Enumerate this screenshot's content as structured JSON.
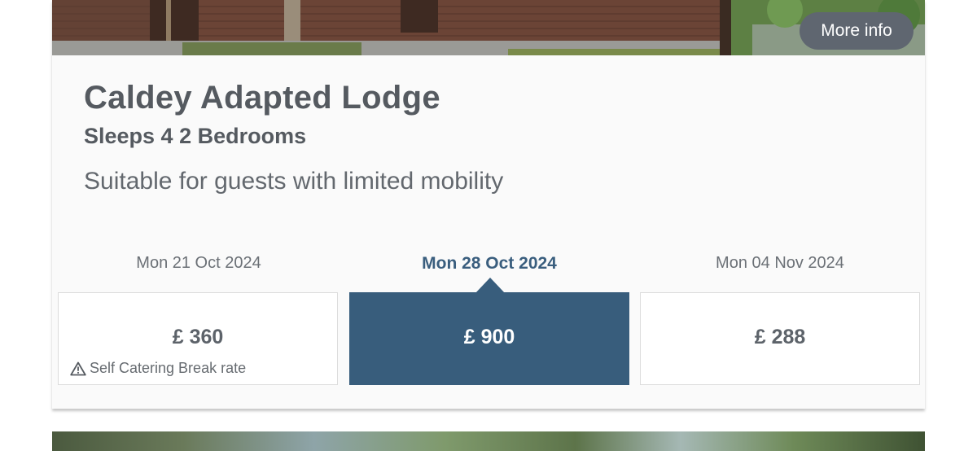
{
  "card": {
    "more_info_label": "More info",
    "title": "Caldey Adapted Lodge",
    "subtitle": "Sleeps 4 2 Bedrooms",
    "description": "Suitable for guests with limited mobility"
  },
  "dates": [
    {
      "label": "Mon 21 Oct 2024",
      "price": "£ 360",
      "note": "Self Catering Break rate",
      "selected": false
    },
    {
      "label": "Mon 28 Oct 2024",
      "price": "£ 900",
      "note": "",
      "selected": true
    },
    {
      "label": "Mon 04 Nov 2024",
      "price": "£ 288",
      "note": "",
      "selected": false
    }
  ],
  "colors": {
    "accent": "#385d7c",
    "text": "#555a60",
    "button_bg": "#5f6670"
  },
  "icons": {
    "rate_note": "warning-icon"
  }
}
